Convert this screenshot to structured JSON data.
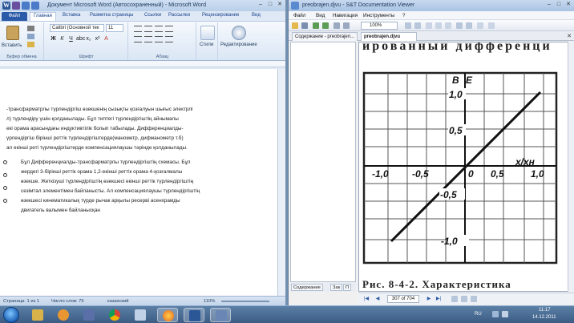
{
  "word": {
    "title": "Документ Microsoft Word (Автосохраненный) - Microsoft Word",
    "file_tab": "Файл",
    "tabs": [
      "Главная",
      "Вставка",
      "Разметка страницы",
      "Ссылки",
      "Рассылки",
      "Рецензирование",
      "Вид"
    ],
    "ribbon": {
      "paste": "Вставить",
      "font_name": "Calibri (Основной тек",
      "font_size": "11",
      "styles": "Стили",
      "editing": "Редактирование",
      "groups": [
        "Буфер обмена",
        "Шрифт",
        "Абзац"
      ]
    },
    "doc_lines": [
      "-трансфарматрлы түрлендіргіш өзекшенің сызықты қозғалуын шығыс электрлі",
      "л) түрлендіру үшін қолданылады. Бұл типтегі түрлендіргіштің айнымалы",
      "екі орама арасындағы индуктивтілік болып табылады.  Дифференциалды-",
      "үрлендіргіш бірінші реттік түрлендіргіштерде(манометр, дифманометр т.б)",
      "ал екінші реті түрлендіргіштерде компенсациялаушы тәрінде қолданылады."
    ],
    "doc_lines2": [
      "Бұл Дифференциалды-трансфарматрлы түрлендіргіштің схемасы. Бұл",
      "жердегі 3-бірінші реттік орама  1,2-екінші реттік орама 4-қозғалмалы",
      "өзекше. Жеткізуші түрлендіргіштің өзекшесі екінші реттік түрлендіргіштің",
      "сезімтал элементімен байланысты. Ал компенсациялаушы түрлендіргіштің",
      "өзекшесі кинематикалық түрде рычак арқылы ресерві асенхрамды",
      "двигатель валымен байланысқан"
    ],
    "status": {
      "page": "Страница: 1 из 1",
      "words": "Число слов: 75",
      "lang": "казахский",
      "zoom": "110%"
    }
  },
  "djvu": {
    "title": "preobrajen.djvu - S&T Documentation Viewer",
    "menu": [
      "Файл",
      "Вид",
      "Навигация",
      "Инструменты",
      "?"
    ],
    "zoom": "100%",
    "tabs": [
      "Содержание - preobrajen...",
      "preobrajen.djvu"
    ],
    "side_tabs": [
      "Содержание",
      "Зак",
      "П"
    ],
    "page_indicator": "307 of 704",
    "scan": {
      "header_text": "ированный дифференци",
      "axis_labels": [
        "B",
        "E"
      ],
      "x_axis_label": "x/xн",
      "y_ticks": [
        "1,0",
        "0,5",
        "-0,5",
        "-1,0"
      ],
      "x_ticks": [
        "-1,0",
        "-0,5",
        "0",
        "0,5",
        "1,0"
      ],
      "caption": "Рис.   8-4-2.   Характеристика"
    }
  },
  "taskbar": {
    "lang": "RU",
    "time": "11:17",
    "date": "14.12.2011"
  }
}
